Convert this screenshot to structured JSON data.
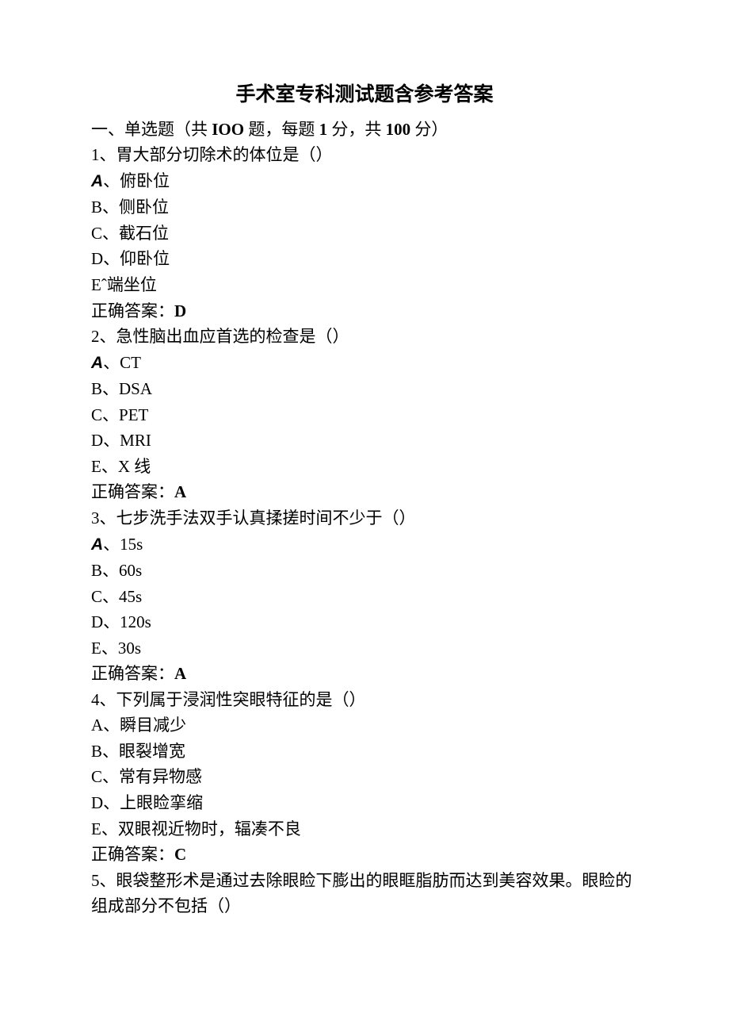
{
  "title": "手术室专科测试题含参考答案",
  "section_header": {
    "prefix": "一、单选题（共 ",
    "count_token": "IOO",
    "mid1": " 题，每题 ",
    "per": "1",
    "mid2": " 分，共 ",
    "total": "100",
    "suffix": " 分）"
  },
  "answer_label": "正确答案：",
  "questions": [
    {
      "stem": "1、胃大部分切除术的体位是（）",
      "options": [
        {
          "label_style": "italic-A",
          "text": "、俯卧位"
        },
        {
          "label_style": "plain",
          "text": "B、侧卧位"
        },
        {
          "label_style": "plain",
          "text": "C、截石位"
        },
        {
          "label_style": "plain",
          "text": "D、仰卧位"
        },
        {
          "label_style": "plain",
          "text": "Eˆ端坐位"
        }
      ],
      "answer": "D"
    },
    {
      "stem": "2、急性脑出血应首选的检查是（）",
      "options": [
        {
          "label_style": "italic-A",
          "text": "、",
          "latin": "CT"
        },
        {
          "label_style": "plain",
          "text": "B、",
          "latin": "DSA"
        },
        {
          "label_style": "plain",
          "text": "C、",
          "latin": "PET"
        },
        {
          "label_style": "plain",
          "text": "D、",
          "latin": "MRI"
        },
        {
          "label_style": "plain",
          "text": "E、X 线"
        }
      ],
      "answer": "A"
    },
    {
      "stem": "3、七步洗手法双手认真揉搓时间不少于（）",
      "options": [
        {
          "label_style": "italic-A",
          "text": "、",
          "latin": "15s"
        },
        {
          "label_style": "plain",
          "text": "B、",
          "latin": "60s"
        },
        {
          "label_style": "plain",
          "text": "C、",
          "latin": "45s"
        },
        {
          "label_style": "plain",
          "text": "D、",
          "latin": "120s"
        },
        {
          "label_style": "plain",
          "text": "E、",
          "latin": "30s"
        }
      ],
      "answer": "A"
    },
    {
      "stem": "4、下列属于浸润性突眼特征的是（）",
      "options": [
        {
          "label_style": "plain",
          "text": "A、瞬目减少"
        },
        {
          "label_style": "plain",
          "text": "B、眼裂增宽"
        },
        {
          "label_style": "plain",
          "text": "C、常有异物感"
        },
        {
          "label_style": "plain",
          "text": "D、上眼睑挛缩"
        },
        {
          "label_style": "plain",
          "text": "E、双眼视近物时，辐凑不良"
        }
      ],
      "answer": "C"
    },
    {
      "stem": "5、眼袋整形术是通过去除眼睑下膨出的眼眶脂肪而达到美容效果。眼睑的组成部分不包括（）",
      "options": [],
      "answer": null
    }
  ]
}
